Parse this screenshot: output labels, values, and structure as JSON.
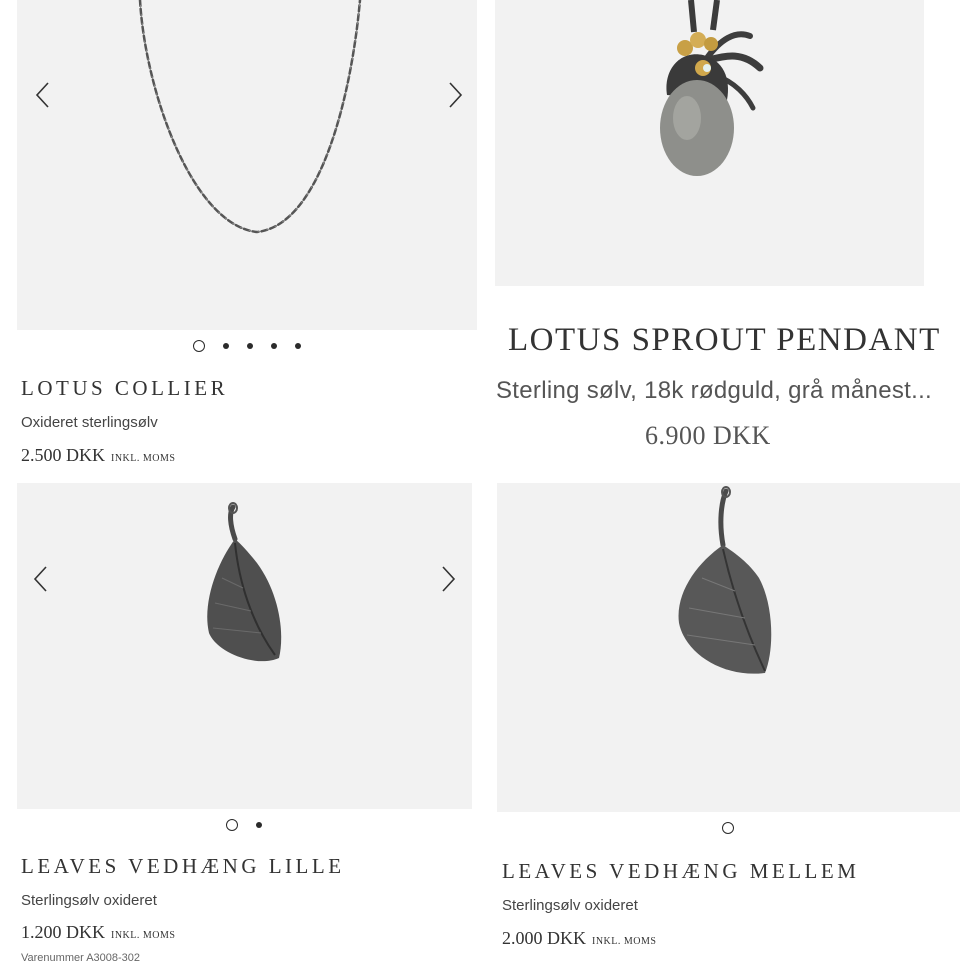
{
  "products": [
    {
      "title": "LOTUS COLLIER",
      "subtitle": "Oxideret sterlingsølv",
      "price": "2.500 DKK",
      "vat": "INKL. MOMS",
      "image": "necklace-chain",
      "slides": 5,
      "active_slide": 1
    },
    {
      "title": "LOTUS SPROUT PENDANT",
      "subtitle": "Sterling sølv, 18k rødguld, grå månest...",
      "price": "6.900 DKK",
      "image": "pendant-grey-moonstone"
    },
    {
      "title": "LEAVES VEDHÆNG LILLE",
      "subtitle": "Sterlingsølv oxideret",
      "price": "1.200 DKK",
      "vat": "INKL. MOMS",
      "sku": "Varenummer A3008-302",
      "image": "leaf-pendant-small",
      "slides": 2,
      "active_slide": 1
    },
    {
      "title": "LEAVES VEDHÆNG MELLEM",
      "subtitle": "Sterlingsølv oxideret",
      "price": "2.000 DKK",
      "vat": "INKL. MOMS",
      "image": "leaf-pendant-medium",
      "slides": 1,
      "active_slide": 1
    }
  ],
  "icons": {
    "prev": "chevron-left-icon",
    "next": "chevron-right-icon"
  },
  "colors": {
    "image_bg": "#f2f2f2",
    "text": "#2b2b2b"
  }
}
